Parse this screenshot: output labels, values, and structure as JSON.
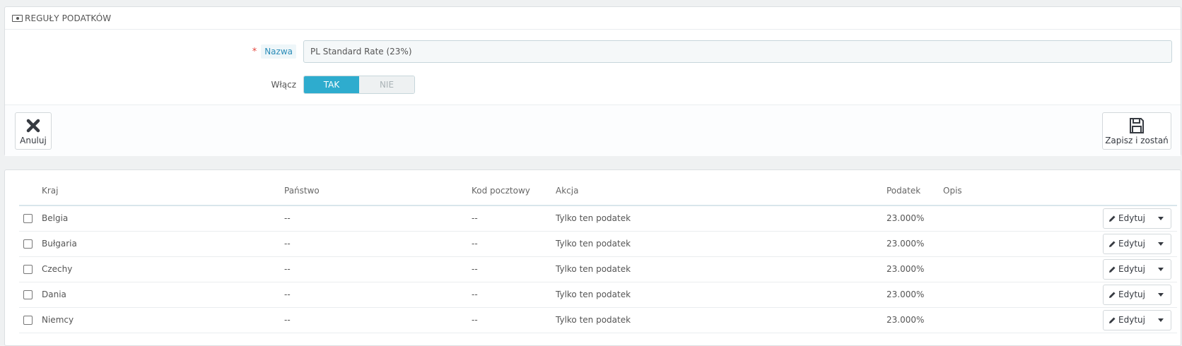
{
  "panel": {
    "title": "REGUŁY PODATKÓW",
    "title_icon": "money-icon"
  },
  "form": {
    "name_required_mark": "*",
    "name_label": "Nazwa",
    "name_value": "PL Standard Rate (23%)",
    "enable_label": "Włącz",
    "enable_on": "TAK",
    "enable_off": "NIE",
    "enable_selected": "TAK"
  },
  "footer": {
    "cancel_label": "Anuluj",
    "cancel_icon": "close-icon",
    "save_label": "Zapisz i zostań",
    "save_icon": "floppy-disk-icon"
  },
  "table": {
    "headers": [
      "Kraj",
      "Państwo",
      "Kod pocztowy",
      "Akcja",
      "Podatek",
      "Opis"
    ],
    "edit_label": "Edytuj",
    "rows": [
      {
        "country": "Belgia",
        "state": "--",
        "zip": "--",
        "action": "Tylko ten podatek",
        "tax": "23.000%",
        "desc": ""
      },
      {
        "country": "Bułgaria",
        "state": "--",
        "zip": "--",
        "action": "Tylko ten podatek",
        "tax": "23.000%",
        "desc": ""
      },
      {
        "country": "Czechy",
        "state": "--",
        "zip": "--",
        "action": "Tylko ten podatek",
        "tax": "23.000%",
        "desc": ""
      },
      {
        "country": "Dania",
        "state": "--",
        "zip": "--",
        "action": "Tylko ten podatek",
        "tax": "23.000%",
        "desc": ""
      },
      {
        "country": "Niemcy",
        "state": "--",
        "zip": "--",
        "action": "Tylko ten podatek",
        "tax": "23.000%",
        "desc": ""
      }
    ]
  },
  "colors": {
    "accent": "#2eacce",
    "required": "#e4473d",
    "label_link": "#2b8cb8"
  }
}
